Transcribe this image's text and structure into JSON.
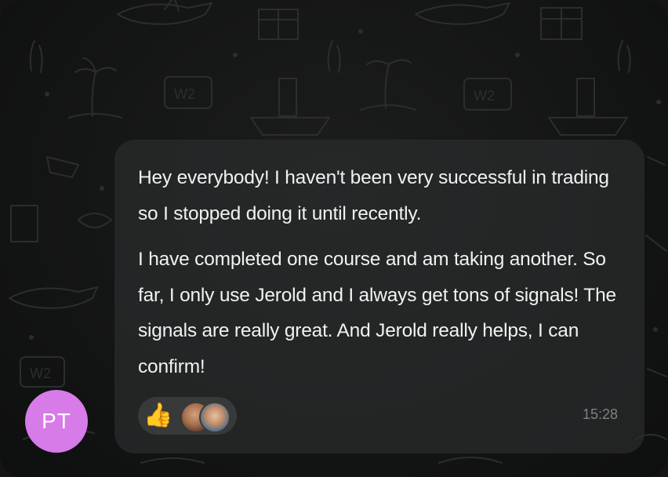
{
  "message": {
    "paragraphs": [
      "Hey everybody! I haven't been very successful in trading so I stopped doing it until recently.",
      "I have completed one course and am taking another. So far, I only use Jerold and I always get tons of signals! The signals are really great. And Jerold really helps, I can confirm!"
    ],
    "time": "15:28"
  },
  "reactions": {
    "emoji": "👍",
    "reactor_avatars": [
      "avatar-photo-1",
      "avatar-photo-2"
    ]
  },
  "sender": {
    "initials": "PT",
    "avatar_color": "#d67be8"
  },
  "colors": {
    "background": "#121313",
    "bubble": "#2a2c2c",
    "text": "#f1f1f1",
    "time": "#7e8180"
  }
}
